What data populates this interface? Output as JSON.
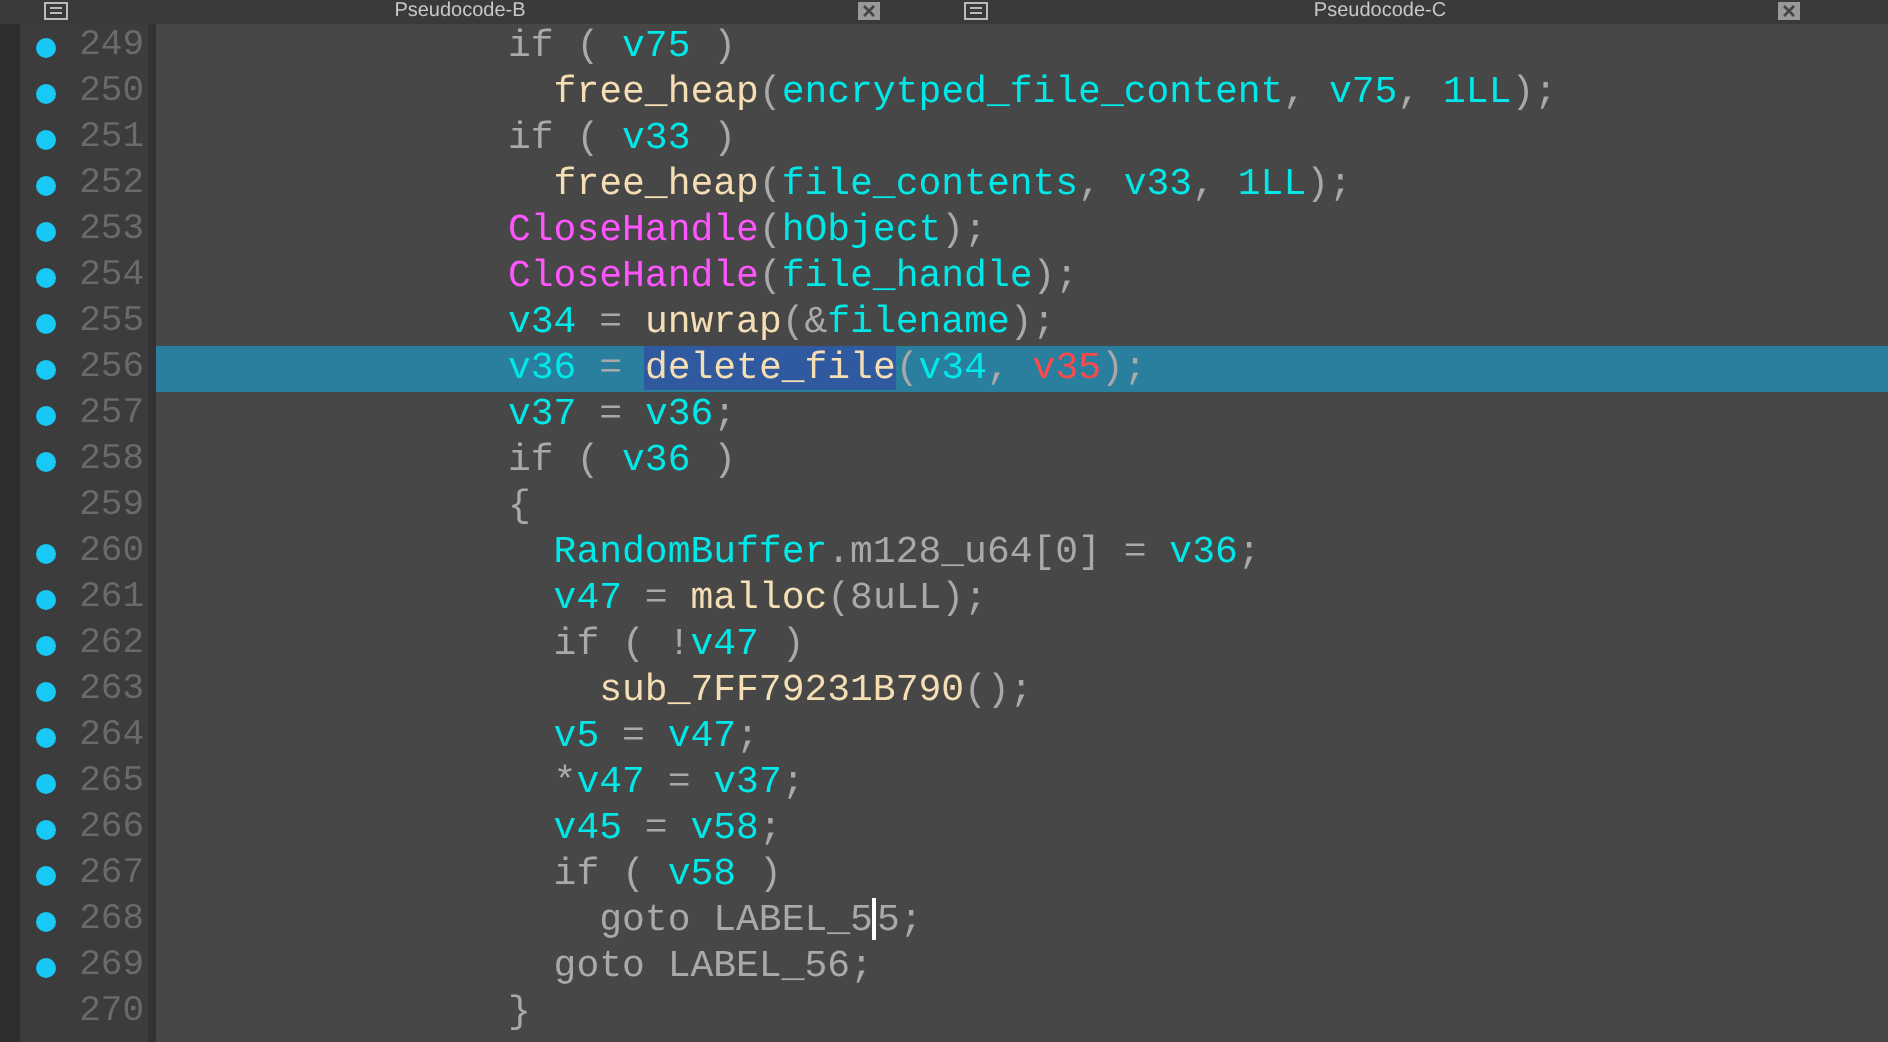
{
  "tabs": [
    {
      "label": "Pseudocode-B",
      "selected": false
    },
    {
      "label": "Pseudocode-C",
      "selected": false
    }
  ],
  "lines": [
    {
      "number": "249",
      "breakpoint": true,
      "current": false,
      "tokens": [
        {
          "kind": "plain",
          "text": "if ( "
        },
        {
          "kind": "var",
          "text": "v75"
        },
        {
          "kind": "plain",
          "text": " )"
        }
      ]
    },
    {
      "number": "250",
      "breakpoint": true,
      "current": false,
      "tokens": [
        {
          "kind": "func",
          "text": "  free_heap"
        },
        {
          "kind": "plain",
          "text": "("
        },
        {
          "kind": "var",
          "text": "encrytped_file_content"
        },
        {
          "kind": "plain",
          "text": ", "
        },
        {
          "kind": "var",
          "text": "v75"
        },
        {
          "kind": "plain",
          "text": ", "
        },
        {
          "kind": "var",
          "text": "1LL"
        },
        {
          "kind": "plain",
          "text": ");"
        }
      ]
    },
    {
      "number": "251",
      "breakpoint": true,
      "current": false,
      "tokens": [
        {
          "kind": "plain",
          "text": "if ( "
        },
        {
          "kind": "var",
          "text": "v33"
        },
        {
          "kind": "plain",
          "text": " )"
        }
      ]
    },
    {
      "number": "252",
      "breakpoint": true,
      "current": false,
      "tokens": [
        {
          "kind": "func",
          "text": "  free_heap"
        },
        {
          "kind": "plain",
          "text": "("
        },
        {
          "kind": "var",
          "text": "file_contents"
        },
        {
          "kind": "plain",
          "text": ", "
        },
        {
          "kind": "var",
          "text": "v33"
        },
        {
          "kind": "plain",
          "text": ", "
        },
        {
          "kind": "var",
          "text": "1LL"
        },
        {
          "kind": "plain",
          "text": ");"
        }
      ]
    },
    {
      "number": "253",
      "breakpoint": true,
      "current": false,
      "tokens": [
        {
          "kind": "import",
          "text": "CloseHandle"
        },
        {
          "kind": "plain",
          "text": "("
        },
        {
          "kind": "var",
          "text": "hObject"
        },
        {
          "kind": "plain",
          "text": ");"
        }
      ]
    },
    {
      "number": "254",
      "breakpoint": true,
      "current": false,
      "tokens": [
        {
          "kind": "import",
          "text": "CloseHandle"
        },
        {
          "kind": "plain",
          "text": "("
        },
        {
          "kind": "var",
          "text": "file_handle"
        },
        {
          "kind": "plain",
          "text": ");"
        }
      ]
    },
    {
      "number": "255",
      "breakpoint": true,
      "current": false,
      "tokens": [
        {
          "kind": "var",
          "text": "v34"
        },
        {
          "kind": "plain",
          "text": " = "
        },
        {
          "kind": "func",
          "text": "unwrap"
        },
        {
          "kind": "plain",
          "text": "(&"
        },
        {
          "kind": "var",
          "text": "filename"
        },
        {
          "kind": "plain",
          "text": ");"
        }
      ]
    },
    {
      "number": "256",
      "breakpoint": true,
      "current": true,
      "tokens": [
        {
          "kind": "var",
          "text": "v36"
        },
        {
          "kind": "plain",
          "text": " = "
        },
        {
          "kind": "func",
          "text": "delete_file",
          "selected": true
        },
        {
          "kind": "plain",
          "text": "("
        },
        {
          "kind": "var",
          "text": "v34"
        },
        {
          "kind": "plain",
          "text": ", "
        },
        {
          "kind": "undefined",
          "text": "v35"
        },
        {
          "kind": "plain",
          "text": ");"
        }
      ]
    },
    {
      "number": "257",
      "breakpoint": true,
      "current": false,
      "tokens": [
        {
          "kind": "var",
          "text": "v37"
        },
        {
          "kind": "plain",
          "text": " = "
        },
        {
          "kind": "var",
          "text": "v36"
        },
        {
          "kind": "plain",
          "text": ";"
        }
      ]
    },
    {
      "number": "258",
      "breakpoint": true,
      "current": false,
      "tokens": [
        {
          "kind": "plain",
          "text": "if ( "
        },
        {
          "kind": "var",
          "text": "v36"
        },
        {
          "kind": "plain",
          "text": " )"
        }
      ]
    },
    {
      "number": "259",
      "breakpoint": false,
      "current": false,
      "tokens": [
        {
          "kind": "plain",
          "text": "{"
        }
      ]
    },
    {
      "number": "260",
      "breakpoint": true,
      "current": false,
      "tokens": [
        {
          "kind": "var",
          "text": "  RandomBuffer"
        },
        {
          "kind": "plain",
          "text": ".m128_u64[0] = "
        },
        {
          "kind": "var",
          "text": "v36"
        },
        {
          "kind": "plain",
          "text": ";"
        }
      ]
    },
    {
      "number": "261",
      "breakpoint": true,
      "current": false,
      "tokens": [
        {
          "kind": "var",
          "text": "  v47"
        },
        {
          "kind": "plain",
          "text": " = "
        },
        {
          "kind": "func",
          "text": "malloc"
        },
        {
          "kind": "plain",
          "text": "(8uLL);"
        }
      ]
    },
    {
      "number": "262",
      "breakpoint": true,
      "current": false,
      "tokens": [
        {
          "kind": "plain",
          "text": "  if ( !"
        },
        {
          "kind": "var",
          "text": "v47"
        },
        {
          "kind": "plain",
          "text": " )"
        }
      ]
    },
    {
      "number": "263",
      "breakpoint": true,
      "current": false,
      "tokens": [
        {
          "kind": "func",
          "text": "    sub_7FF79231B790"
        },
        {
          "kind": "plain",
          "text": "();"
        }
      ]
    },
    {
      "number": "264",
      "breakpoint": true,
      "current": false,
      "tokens": [
        {
          "kind": "var",
          "text": "  v5"
        },
        {
          "kind": "plain",
          "text": " = "
        },
        {
          "kind": "var",
          "text": "v47"
        },
        {
          "kind": "plain",
          "text": ";"
        }
      ]
    },
    {
      "number": "265",
      "breakpoint": true,
      "current": false,
      "tokens": [
        {
          "kind": "plain",
          "text": "  *"
        },
        {
          "kind": "var",
          "text": "v47"
        },
        {
          "kind": "plain",
          "text": " = "
        },
        {
          "kind": "var",
          "text": "v37"
        },
        {
          "kind": "plain",
          "text": ";"
        }
      ]
    },
    {
      "number": "266",
      "breakpoint": true,
      "current": false,
      "tokens": [
        {
          "kind": "var",
          "text": "  v45"
        },
        {
          "kind": "plain",
          "text": " = "
        },
        {
          "kind": "var",
          "text": "v58"
        },
        {
          "kind": "plain",
          "text": ";"
        }
      ]
    },
    {
      "number": "267",
      "breakpoint": true,
      "current": false,
      "tokens": [
        {
          "kind": "plain",
          "text": "  if ( "
        },
        {
          "kind": "var",
          "text": "v58"
        },
        {
          "kind": "plain",
          "text": " )"
        }
      ]
    },
    {
      "number": "268",
      "breakpoint": true,
      "current": false,
      "tokens": [
        {
          "kind": "plain",
          "text": "    goto LABEL_5",
          "caret_after": true
        },
        {
          "kind": "plain",
          "text": "5;"
        }
      ]
    },
    {
      "number": "269",
      "breakpoint": true,
      "current": false,
      "tokens": [
        {
          "kind": "plain",
          "text": "  goto LABEL_56;"
        }
      ]
    },
    {
      "number": "270",
      "breakpoint": false,
      "current": false,
      "tokens": [
        {
          "kind": "plain",
          "text": "}"
        }
      ]
    }
  ]
}
